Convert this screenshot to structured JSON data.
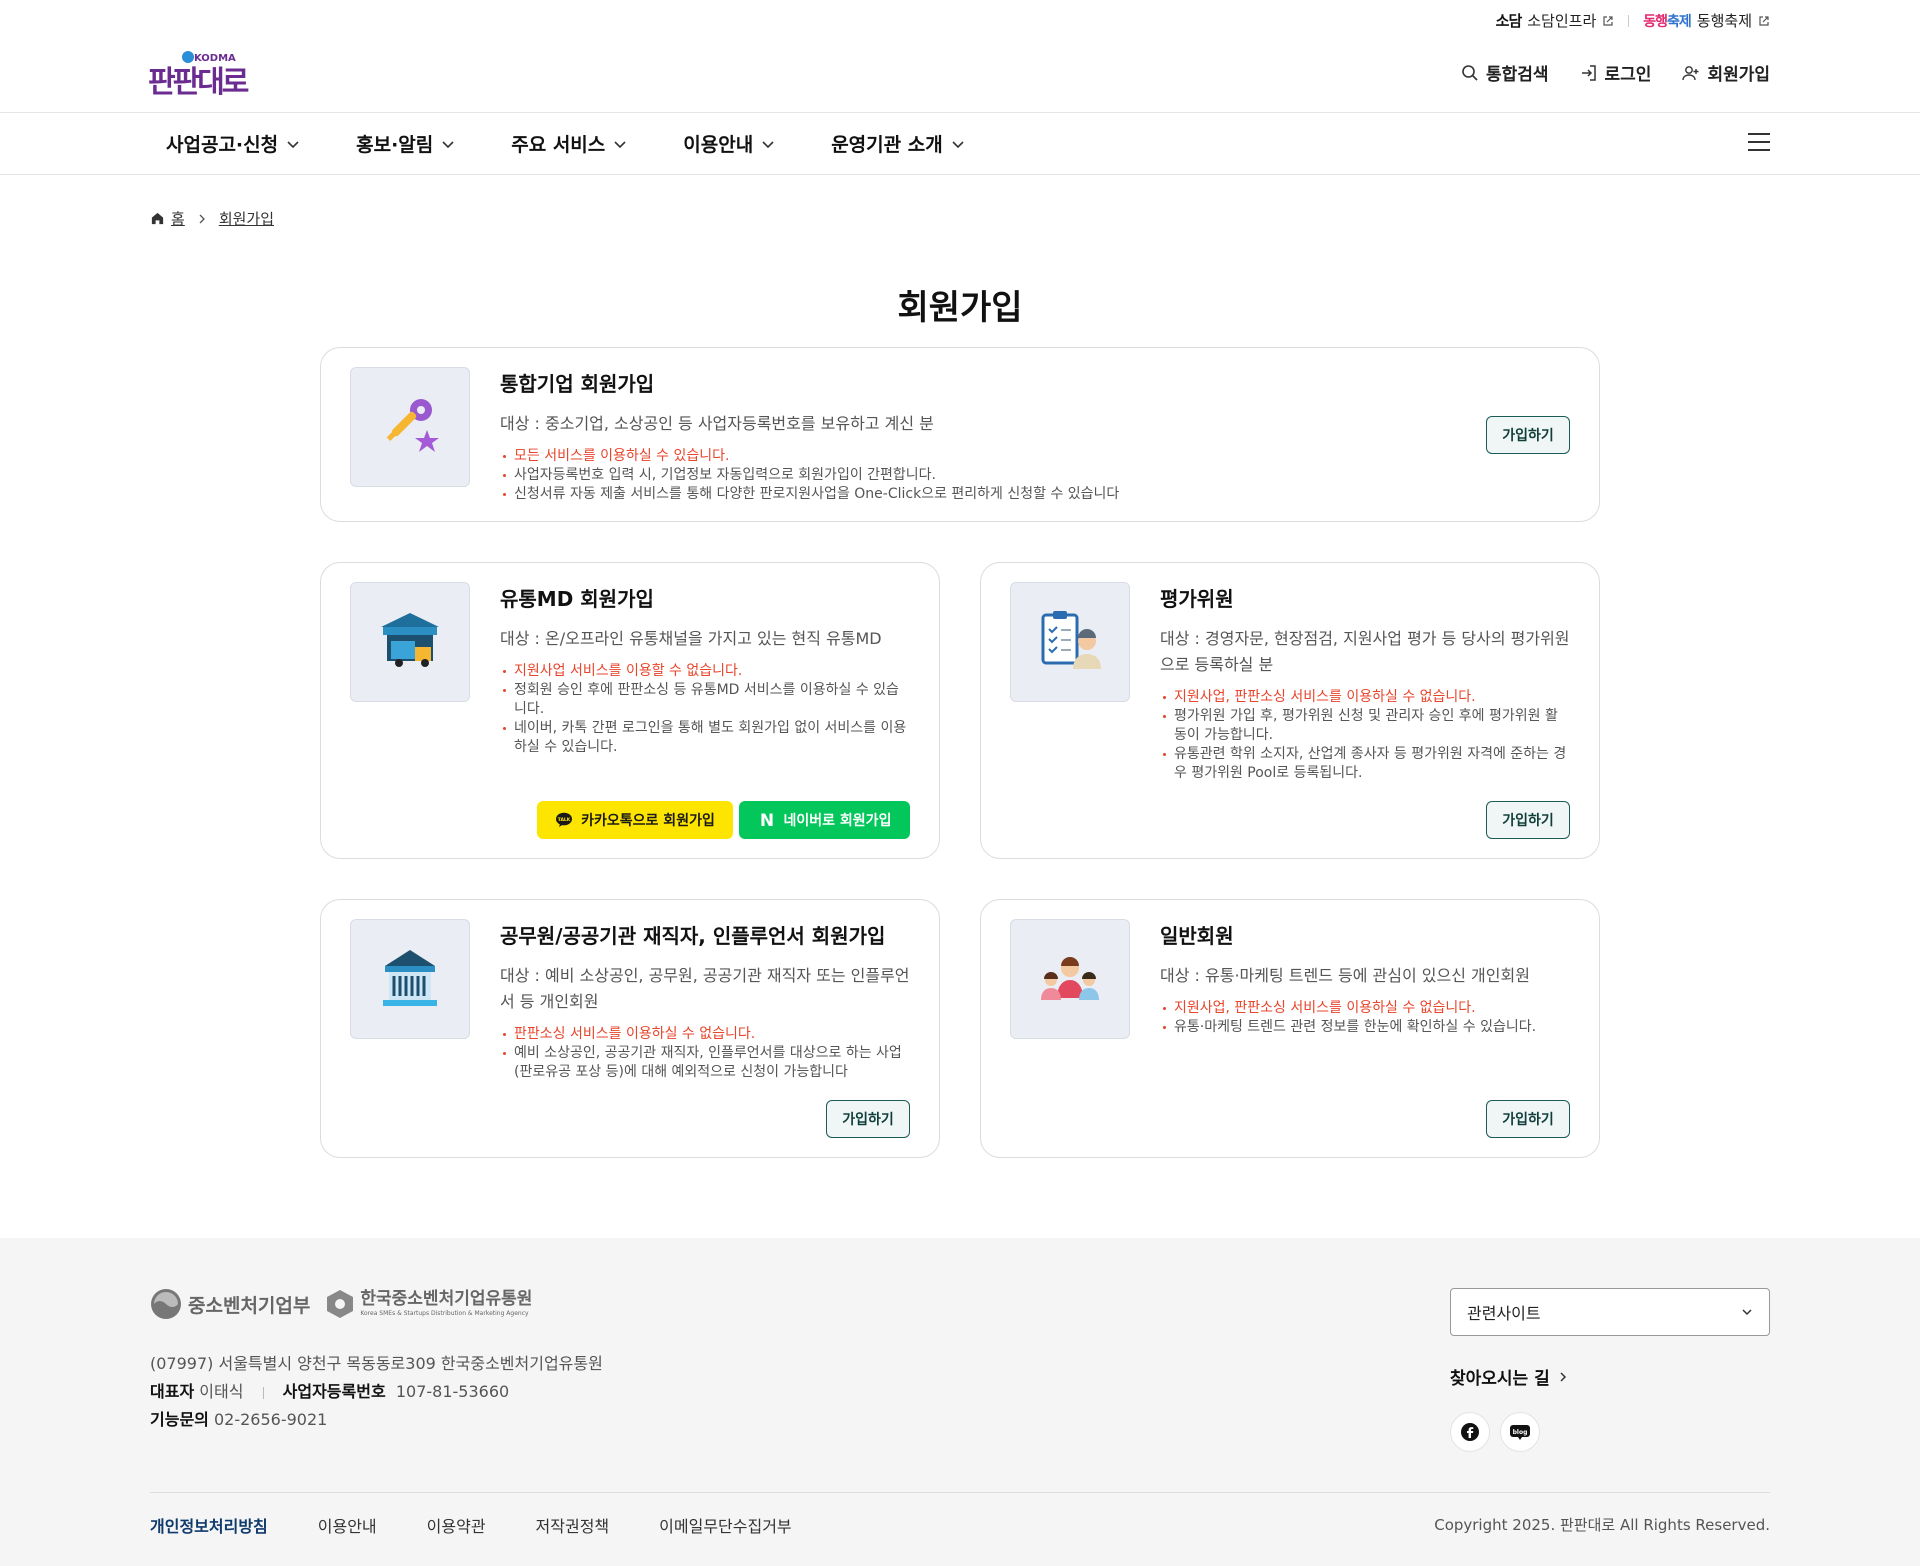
{
  "util": {
    "sodam_logo": "소담",
    "sodam_label": "소담인프라",
    "festa_logo_a": "동행",
    "festa_logo_b": "축제",
    "festa_label": "동행축제"
  },
  "logo": {
    "badge": "KODMA",
    "text": "판판대로"
  },
  "top_menu": {
    "search": "통합검색",
    "login": "로그인",
    "signup": "회원가입"
  },
  "gnb": [
    "사업공고·신청",
    "홍보·알림",
    "주요 서비스",
    "이용안내",
    "운영기관 소개"
  ],
  "breadcrumb": {
    "home": "홈",
    "current": "회원가입"
  },
  "page_title": "회원가입",
  "cards": {
    "integrated": {
      "title": "통합기업 회원가입",
      "target": "대상 : 중소기업, 소상공인 등 사업자등록번호를 보유하고 계신 분",
      "notes": [
        "모든 서비스를 이용하실 수 있습니다.",
        "사업자등록번호 입력 시, 기업정보 자동입력으로 회원가입이 간편합니다.",
        "신청서류 자동 제출 서비스를 통해 다양한 판로지원사업을 One-Click으로 편리하게 신청할 수 있습니다"
      ],
      "button": "가입하기"
    },
    "md": {
      "title": "유통MD 회원가입",
      "target": "대상 : 온/오프라인 유통채널을 가지고 있는 현직 유통MD",
      "notes": [
        "지원사업 서비스를 이용할 수 없습니다.",
        "정회원 승인 후에 판판소싱 등 유통MD 서비스를 이용하실 수 있습니다.",
        "네이버, 카톡 간편 로그인을 통해 별도 회원가입 없이 서비스를 이용하실 수 있습니다."
      ],
      "kakao_button": "카카오톡으로 회원가입",
      "kakao_badge": "TALK",
      "naver_button": "네이버로 회원가입",
      "naver_badge": "N"
    },
    "evaluator": {
      "title": "평가위원",
      "target": "대상 : 경영자문, 현장점검, 지원사업 평가 등 당사의 평가위원으로 등록하실 분",
      "notes": [
        "지원사업, 판판소싱 서비스를 이용하실 수 없습니다.",
        "평가위원 가입 후, 평가위원 신청 및 관리자 승인 후에 평가위원 활동이 가능합니다.",
        "유통관련 학위 소지자, 산업계 종사자 등 평가위원 자격에 준하는 경우 평가위원 Pool로 등록됩니다."
      ],
      "button": "가입하기"
    },
    "public": {
      "title": "공무원/공공기관 재직자, 인플루언서 회원가입",
      "target": "대상 : 예비 소상공인, 공무원, 공공기관 재직자 또는 인플루언서 등 개인회원",
      "notes": [
        "판판소싱 서비스를 이용하실 수 없습니다.",
        "예비 소상공인, 공공기관 재직자, 인플루언서를 대상으로 하는 사업(판로유공 포상 등)에 대해 예외적으로 신청이 가능합니다"
      ],
      "button": "가입하기"
    },
    "general": {
      "title": "일반회원",
      "target": "대상 : 유통·마케팅 트렌드 등에 관심이 있으신 개인회원",
      "notes": [
        "지원사업, 판판소싱 서비스를 이용하실 수 없습니다.",
        "유통·마케팅 트렌드 관련 정보를 한눈에 확인하실 수 있습니다."
      ],
      "button": "가입하기"
    }
  },
  "footer": {
    "ministry": "중소벤처기업부",
    "agency": "한국중소벤처기업유통원",
    "agency_sub": "Korea SMEs & Startups Distribution & Marketing Agency",
    "address": "(07997) 서울특별시 양천구 목동동로309 한국중소벤처기업유통원",
    "ceo_label": "대표자",
    "ceo": "이태식",
    "biz_label": "사업자등록번호",
    "biz_no": "107-81-53660",
    "tel_label": "기능문의",
    "tel": "02-2656-9021",
    "related": "관련사이트",
    "directions": "찾아오시는 길",
    "sns_blog": "blog",
    "links": [
      "개인정보처리방침",
      "이용안내",
      "이용약관",
      "저작권정책",
      "이메일무단수집거부"
    ],
    "copyright": "Copyright 2025. 판판대로 All Rights Reserved."
  },
  "colors": {
    "accent": "#1b5c57",
    "warn": "#e8452b",
    "kakao": "#fee500",
    "naver": "#03c75a",
    "brand": "#6a2c91"
  }
}
